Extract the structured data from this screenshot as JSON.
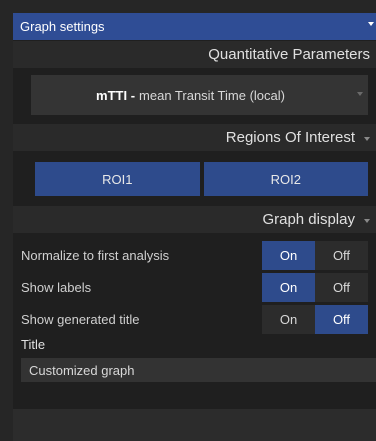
{
  "panel": {
    "title": "Graph settings"
  },
  "quantitative": {
    "header": "Quantitative Parameters",
    "selected_code": "mTTI -",
    "selected_desc": "mean Transit Time (local)"
  },
  "roi": {
    "header": "Regions Of Interest",
    "items": [
      "ROI1",
      "ROI2"
    ]
  },
  "graph_display": {
    "header": "Graph display",
    "rows": [
      {
        "label": "Normalize to first analysis",
        "on": "On",
        "off": "Off",
        "value": "On"
      },
      {
        "label": "Show labels",
        "on": "On",
        "off": "Off",
        "value": "On"
      },
      {
        "label": "Show generated title",
        "on": "On",
        "off": "Off",
        "value": "Off"
      }
    ],
    "title_label": "Title",
    "title_value": "Customized graph"
  },
  "colors": {
    "accent": "#2e4b8c",
    "titlebar": "#2f4d95",
    "background": "#1f1f1f"
  }
}
